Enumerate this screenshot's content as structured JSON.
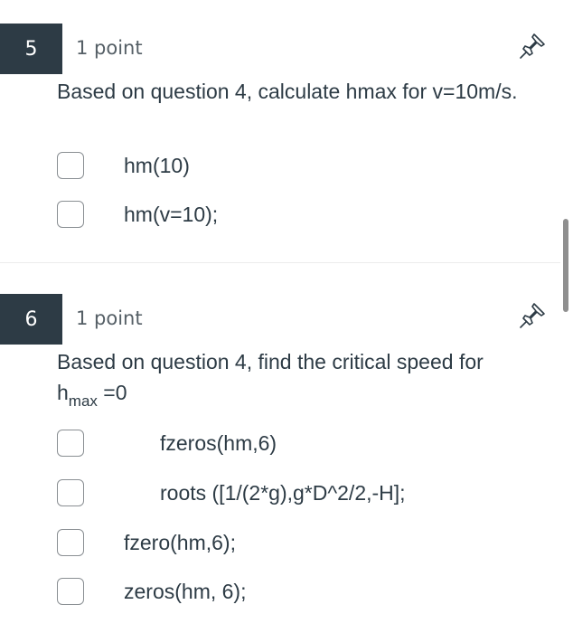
{
  "questions": [
    {
      "number": "5",
      "points": "1 point",
      "text": "Based on question 4, calculate hmax for v=10m/s.",
      "answers": [
        "hm(10)",
        "hm(v=10);"
      ]
    },
    {
      "number": "6",
      "points": "1 point",
      "text_main": "Based on question 4, find  the critical speed for",
      "text_h": "h",
      "text_sub": "max",
      "text_tail": " =0",
      "answers": [
        "fzeros(hm,6)",
        "roots ([1/(2*g),g*D^2/2,-H];",
        "fzero(hm,6);",
        "zeros(hm, 6);"
      ]
    }
  ],
  "icons": {
    "pin": "pin-icon",
    "checkbox": "checkbox-icon"
  },
  "colors": {
    "number_badge": "#2d3b45",
    "text": "#2d3b45",
    "points_text": "#555f66",
    "checkbox_border": "#8a8f93",
    "scrollbar": "#8f8f8f"
  }
}
